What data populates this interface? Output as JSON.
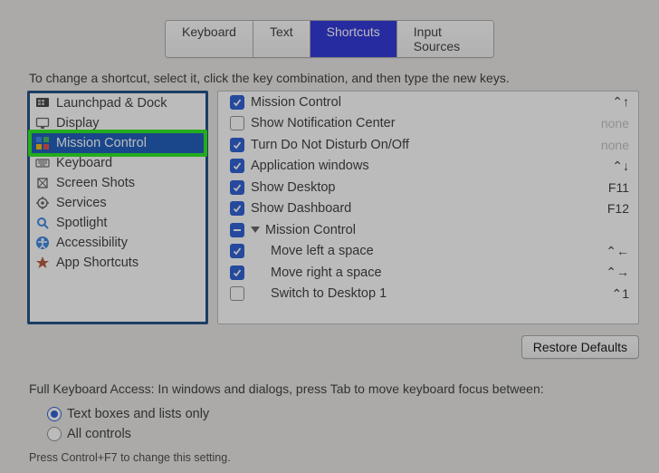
{
  "tabs": {
    "keyboard": "Keyboard",
    "text": "Text",
    "shortcuts": "Shortcuts",
    "input_sources": "Input Sources",
    "active_index": 2
  },
  "instruction": "To change a shortcut, select it, click the key combination, and then type the new keys.",
  "categories": [
    {
      "label": "Launchpad & Dock",
      "icon": "launchpad"
    },
    {
      "label": "Display",
      "icon": "display"
    },
    {
      "label": "Mission Control",
      "icon": "mission-control",
      "selected": true
    },
    {
      "label": "Keyboard",
      "icon": "keyboard"
    },
    {
      "label": "Screen Shots",
      "icon": "screenshots"
    },
    {
      "label": "Services",
      "icon": "services"
    },
    {
      "label": "Spotlight",
      "icon": "spotlight"
    },
    {
      "label": "Accessibility",
      "icon": "accessibility"
    },
    {
      "label": "App Shortcuts",
      "icon": "app-shortcuts"
    }
  ],
  "shortcuts": [
    {
      "checked": true,
      "label": "Mission Control",
      "key": "⌃↑",
      "key_dim": false,
      "indent": 0
    },
    {
      "checked": false,
      "label": "Show Notification Center",
      "key": "none",
      "key_dim": true,
      "indent": 0
    },
    {
      "checked": true,
      "label": "Turn Do Not Disturb On/Off",
      "key": "none",
      "key_dim": true,
      "indent": 0
    },
    {
      "checked": true,
      "label": "Application windows",
      "key": "⌃↓",
      "key_dim": false,
      "indent": 0
    },
    {
      "checked": true,
      "label": "Show Desktop",
      "key": "F11",
      "key_dim": false,
      "indent": 0
    },
    {
      "checked": true,
      "label": "Show Dashboard",
      "key": "F12",
      "key_dim": false,
      "indent": 0
    },
    {
      "checked": "mixed",
      "label": "Mission Control",
      "key": "",
      "key_dim": false,
      "indent": 0,
      "disclosure": true
    },
    {
      "checked": true,
      "label": "Move left a space",
      "key": "⌃←",
      "key_dim": false,
      "indent": 2
    },
    {
      "checked": true,
      "label": "Move right a space",
      "key": "⌃→",
      "key_dim": false,
      "indent": 2
    },
    {
      "checked": false,
      "label": "Switch to Desktop 1",
      "key": "⌃1",
      "key_dim": false,
      "indent": 2
    }
  ],
  "restore_defaults": "Restore Defaults",
  "full_keyboard_access": "Full Keyboard Access: In windows and dialogs, press Tab to move keyboard focus between:",
  "radios": {
    "text_boxes": "Text boxes and lists only",
    "all_controls": "All controls",
    "selected": 0
  },
  "hint": "Press Control+F7 to change this setting.",
  "colors": {
    "accent": "#1951d1",
    "tab_active": "#1c22d6",
    "highlight_ring": "#17e80c",
    "category_selected": "#094eb5"
  }
}
